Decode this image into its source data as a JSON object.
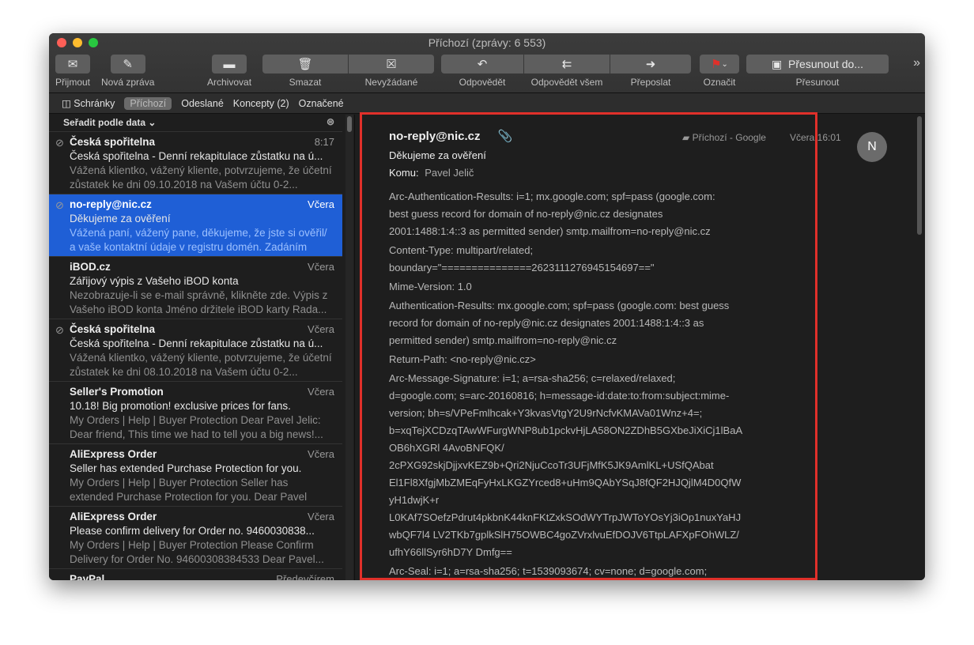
{
  "window": {
    "title": "Příchozí (zprávy: 6 553)"
  },
  "toolbar": {
    "get": "Přijmout",
    "new": "Nová zpráva",
    "archive": "Archivovat",
    "delete": "Smazat",
    "junk": "Nevyžádané",
    "reply": "Odpovědět",
    "reply_all": "Odpovědět všem",
    "forward": "Přeposlat",
    "flag": "Označit",
    "move_btn": "Přesunout do...",
    "move": "Přesunout",
    "more": "»"
  },
  "favorites": {
    "mailboxes": "Schránky",
    "inbox": "Příchozí",
    "sent": "Odeslané",
    "drafts": "Koncepty (2)",
    "flagged": "Označené"
  },
  "list": {
    "sort": "Seřadit podle data ⌄",
    "items": [
      {
        "from": "Česká spořitelna",
        "date": "8:17",
        "subject": "Česká spořitelna - Denní rekapitulace zůstatku na ú...",
        "preview": "Vážená klientko, vážený kliente, potvrzujeme, že účetní zůstatek ke dni 09.10.2018 na Vašem účtu 0-2...",
        "attach": true
      },
      {
        "from": "no-reply@nic.cz",
        "date": "Včera",
        "subject": "Děkujeme za ověření",
        "preview": "Vážená paní, vážený pane, děkujeme, že jste si ověřil/ a vaše kontaktní údaje v registru domén. Zadáním kód...",
        "attach": true,
        "selected": true
      },
      {
        "from": "iBOD.cz",
        "date": "Včera",
        "subject": "Zářijový výpis z Vašeho iBOD konta",
        "preview": "Nezobrazuje-li se e-mail správně, klikněte zde. Výpis z Vašeho iBOD konta Jméno držitele iBOD karty Rada...",
        "attach": false
      },
      {
        "from": "Česká spořitelna",
        "date": "Včera",
        "subject": "Česká spořitelna - Denní rekapitulace zůstatku na ú...",
        "preview": "Vážená klientko, vážený kliente, potvrzujeme, že účetní zůstatek ke dni 08.10.2018 na Vašem účtu 0-2...",
        "attach": true
      },
      {
        "from": "Seller's Promotion",
        "date": "Včera",
        "subject": "10.18!  Big promotion! exclusive prices for fans.",
        "preview": "My Orders | Help | Buyer Protection Dear Pavel Jelic: Dear friend, This time we had to tell you a big news!...",
        "attach": false
      },
      {
        "from": "AliExpress Order",
        "date": "Včera",
        "subject": "Seller has extended Purchase Protection for you.",
        "preview": "My Orders | Help | Buyer Protection Seller has extended Purchase Protection for you. Dear Pavel Jeli...",
        "attach": false
      },
      {
        "from": "AliExpress Order",
        "date": "Včera",
        "subject": "Please confirm delivery  for Order no. 9460030838...",
        "preview": "My Orders | Help | Buyer Protection Please Confirm Delivery for Order No. 94600308384533 Dear Pavel...",
        "attach": false
      },
      {
        "from": "PayPal",
        "date": "Předevčírem",
        "subject": "",
        "preview": "",
        "attach": false
      }
    ]
  },
  "message": {
    "from": "no-reply@nic.cz",
    "subject": "Děkujeme za ověření",
    "to_label": "Komu:",
    "to": "Pavel Jelič",
    "mailbox": "Příchozí - Google",
    "date": "Včera 16:01",
    "avatar": "N",
    "headers": [
      [
        "Arc-Authentication-Results: i=1; mx.google.com; spf=pass (google.com:",
        "best guess record for domain of no-reply@nic.cz designates",
        "2001:1488:1:4::3 as permitted sender) smtp.mailfrom=no-reply@nic.cz"
      ],
      [
        "Content-Type: multipart/related;",
        "boundary=\"===============2623111276945154697==\""
      ],
      [
        "Mime-Version: 1.0"
      ],
      [
        "Authentication-Results: mx.google.com; spf=pass (google.com: best guess",
        "record for domain of no-reply@nic.cz designates 2001:1488:1:4::3 as",
        "permitted sender) smtp.mailfrom=no-reply@nic.cz"
      ],
      [
        "Return-Path: <no-reply@nic.cz>"
      ],
      [
        "Arc-Message-Signature: i=1; a=rsa-sha256; c=relaxed/relaxed;",
        "d=google.com; s=arc-20160816; h=message-id:date:to:from:subject:mime-",
        "version; bh=s/VPeFmlhcak+Y3kvasVtgY2U9rNcfvKMAVa01Wnz+4=;",
        "b=xqTejXCDzqTAwWFurgWNP8ub1pckvHjLA58ON2ZDhB5GXbeJiXiCj1lBaA",
        "OB6hXGRl 4AvoBNFQK/",
        "2cPXG92skjDjjxvKEZ9b+Qri2NjuCcoTr3UFjMfK5JK9AmlKL+USfQAbat",
        "El1Fl8XfgjMbZMEqFyHxLKGZYrced8+uHm9QAbYSqJ8fQF2HJQjlM4D0QfW",
        "yH1dwjK+r",
        "L0KAf7SOefzPdrut4pkbnK44knFKtZxkSOdWYTrpJWToYOsYj3iOp1nuxYaHJ",
        "wbQF7l4 LV2TKb7gplkSlH75OWBC4goZVrxlvuEfDOJV6TtpLAFXpFOhWLZ/",
        "ufhY66llSyr6hD7Y Dmfg=="
      ],
      [
        "Arc-Seal: i=1; a=rsa-sha256; t=1539093674; cv=none; d=google.com;"
      ]
    ]
  },
  "colors": {
    "selection": "#1f5fd6",
    "highlight": "#e0302a"
  }
}
